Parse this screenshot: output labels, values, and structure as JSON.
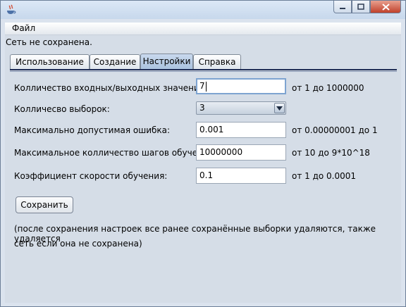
{
  "window": {
    "icon": "java-cup-icon",
    "buttons": [
      "minimize-icon",
      "maximize-icon",
      "close-icon"
    ]
  },
  "menu": {
    "file_label": "Файл"
  },
  "status_text": "Сеть не сохранена.",
  "tabs": [
    {
      "label": "Использование",
      "active": false
    },
    {
      "label": "Создание",
      "active": false
    },
    {
      "label": "Настройки",
      "active": true
    },
    {
      "label": "Справка",
      "active": false
    }
  ],
  "settings": {
    "io_count": {
      "label": "Колличество входных/выходных значений:",
      "value": "7",
      "hint": "от 1 до 1000000"
    },
    "samples": {
      "label": "Колличесво выборок:",
      "value": "3"
    },
    "max_error": {
      "label": "Максимально допустимая ошибка:",
      "value": "0.001",
      "hint": "от 0.00000001 до 1"
    },
    "max_steps": {
      "label": "Максимальное колличество шагов обучения:",
      "value": "10000000",
      "hint": "от 10 до 9*10^18"
    },
    "learn_rate": {
      "label": "Коэффициент скорости обучения:",
      "value": "0.1",
      "hint": "от 1 до 0.0001"
    }
  },
  "save_label": "Сохранить",
  "note": {
    "line1": "(после сохранения настроек все ранее сохранённые выборки удаляются, также удаляется",
    "line2": "сеть если она не сохранена)"
  }
}
